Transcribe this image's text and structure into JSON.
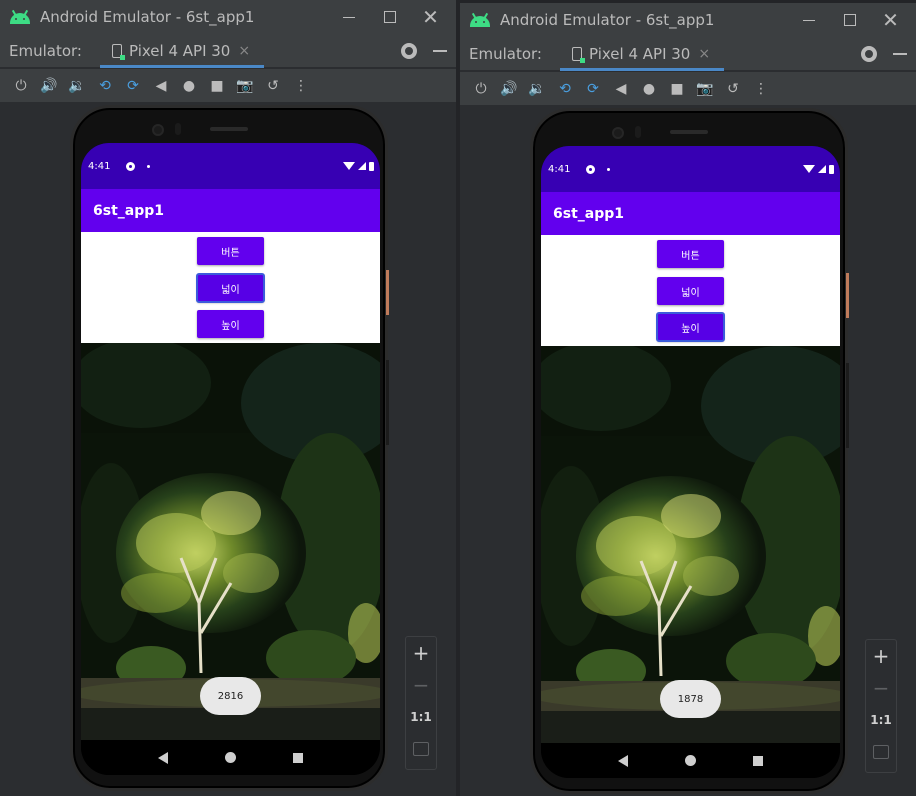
{
  "windows": [
    {
      "title": "Android Emulator - 6st_app1",
      "tab_caption": "Emulator:",
      "device_tab": "Pixel 4 API 30",
      "tab_close": "×",
      "status_time": "4:41",
      "app_title": "6st_app1",
      "buttons": [
        "버튼",
        "넓이",
        "높이"
      ],
      "focused_button": "넓이",
      "toast_text": "2816",
      "zoom": {
        "plus": "+",
        "minus": "−",
        "one_to_one": "1:1"
      }
    },
    {
      "title": "Android Emulator - 6st_app1",
      "tab_caption": "Emulator:",
      "device_tab": "Pixel 4 API 30",
      "tab_close": "×",
      "status_time": "4:41",
      "app_title": "6st_app1",
      "buttons": [
        "버튼",
        "넓이",
        "높이"
      ],
      "focused_button": "높이",
      "toast_text": "1878",
      "zoom": {
        "plus": "+",
        "minus": "−",
        "one_to_one": "1:1"
      }
    }
  ],
  "toolbar_icons": [
    "power-icon",
    "volume-up-icon",
    "volume-down-icon",
    "rotate-left-icon",
    "rotate-right-icon",
    "back-icon",
    "home-icon",
    "overview-icon",
    "camera-icon",
    "snapshot-icon",
    "more-icon"
  ],
  "colors": {
    "status_bar": "#3700b3",
    "app_bar": "#6200ee",
    "button": "#6200ee",
    "ide_background": "#2b2d30",
    "ide_chrome": "#3c3f41",
    "tab_underline": "#4a88c7",
    "android_green": "#3ddc84"
  }
}
